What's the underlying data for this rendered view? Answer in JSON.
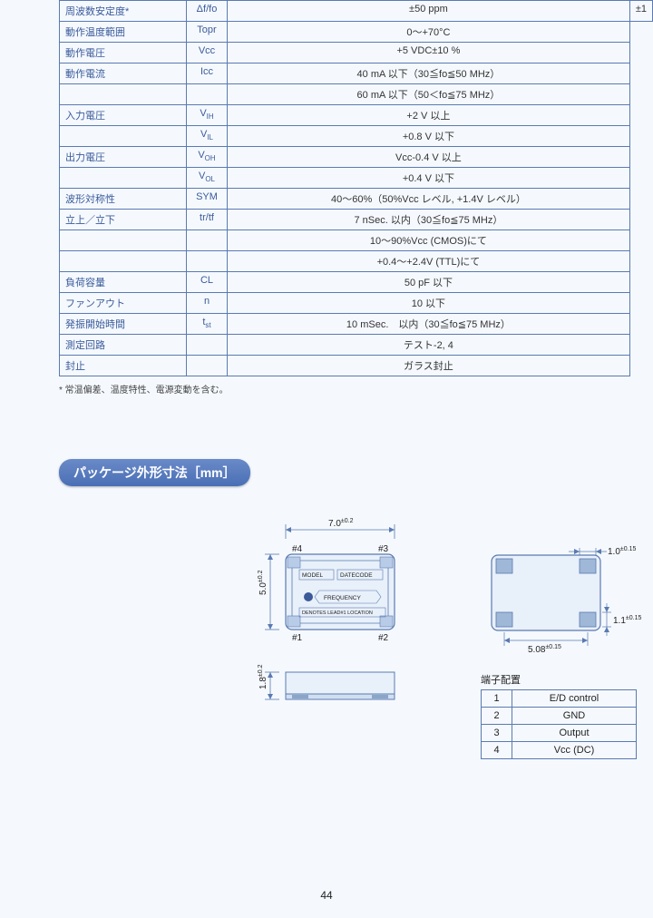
{
  "spec_rows": [
    {
      "label": "周波数安定度*",
      "sym": "Δf/fo",
      "val": "±50 ppm",
      "cut": "±1"
    },
    {
      "label": "動作温度範囲",
      "sym": "Topr",
      "val": "0～+70°C"
    },
    {
      "label": "動作電圧",
      "sym": "Vcc",
      "val": "+5 VDC±10 %"
    },
    {
      "label": "動作電流",
      "sym": "Icc",
      "val": "40 mA 以下（30≦fo≦50 MHz）"
    },
    {
      "label": "",
      "sym": "",
      "val": "60 mA 以下（50＜fo≦75 MHz）",
      "noborder": true
    },
    {
      "label": "入力電圧",
      "sym": "V",
      "sub": "IH",
      "val": "+2 V 以上"
    },
    {
      "label": "",
      "sym": "V",
      "sub": "IL",
      "val": "+0.8 V 以下",
      "nolabelborder": true
    },
    {
      "label": "出力電圧",
      "sym": "V",
      "sub": "OH",
      "val": "Vcc-0.4 V 以上"
    },
    {
      "label": "",
      "sym": "V",
      "sub": "OL",
      "val": "+0.4 V 以下",
      "nolabelborder": true
    },
    {
      "label": "波形対称性",
      "sym": "SYM",
      "val": "40～60%（50%Vcc レベル, +1.4V レベル）"
    },
    {
      "label": "立上／立下",
      "sym": "tr/tf",
      "val": "7 nSec. 以内（30≦fo≦75 MHz）"
    },
    {
      "label": "",
      "sym": "",
      "val": "10～90%Vcc (CMOS)にて",
      "noborder": true
    },
    {
      "label": "",
      "sym": "",
      "val": "+0.4～+2.4V (TTL)にて",
      "noborder": true
    },
    {
      "label": "負荷容量",
      "sym": "CL",
      "val": "50 pF 以下"
    },
    {
      "label": "ファンアウト",
      "sym": "n",
      "val": "10 以下"
    },
    {
      "label": "発振開始時間",
      "sym": "t",
      "sub": "st",
      "val": "10 mSec.　以内（30≦fo≦75 MHz）"
    },
    {
      "label": "測定回路",
      "sym": "",
      "val": "テスト-2, 4"
    },
    {
      "label": "封止",
      "sym": "",
      "val": "ガラス封止"
    }
  ],
  "footnote": "* 常温偏差、温度特性、電源変動を含む。",
  "section_title": "パッケージ外形寸法［mm］",
  "dims": {
    "w": "7.0",
    "w_tol": "±0.2",
    "h": "5.0",
    "h_tol": "±0.2",
    "t": "1.8",
    "t_tol": "±0.2",
    "padw": "1.0",
    "padw_tol": "±0.15",
    "padh": "1.1",
    "padh_tol": "±0.15",
    "pitch": "5.08",
    "pitch_tol": "±0.15"
  },
  "pin_corners": {
    "tl": "#4",
    "tr": "#3",
    "bl": "#1",
    "br": "#2"
  },
  "chip_text": {
    "model": "MODEL",
    "date": "DATECODE",
    "freq": "FREQUENCY",
    "note": "DENOTES LEAD#1 LOCATION"
  },
  "pin_title": "端子配置",
  "pins": [
    {
      "n": "1",
      "fn": "E/D control"
    },
    {
      "n": "2",
      "fn": "GND"
    },
    {
      "n": "3",
      "fn": "Output"
    },
    {
      "n": "4",
      "fn": "Vcc (DC)"
    }
  ],
  "page_number": "44"
}
